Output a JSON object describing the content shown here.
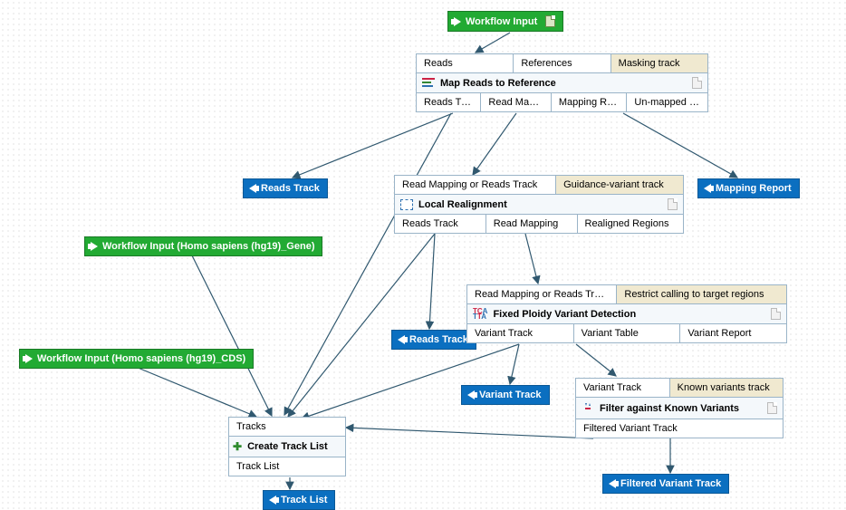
{
  "inputs": {
    "top": "Workflow Input",
    "gene": "Workflow Input (Homo sapiens (hg19)_Gene)",
    "cds": "Workflow Input (Homo sapiens (hg19)_CDS)"
  },
  "outputs": {
    "reads_track_1": "Reads Track",
    "mapping_report": "Mapping Report",
    "reads_track_2": "Reads Track",
    "variant_track": "Variant Track",
    "filtered_variant": "Filtered Variant Track",
    "track_list": "Track List"
  },
  "map": {
    "in": {
      "reads": "Reads",
      "refs": "References",
      "mask": "Masking track"
    },
    "title": "Map Reads to Reference",
    "out": {
      "rt": "Reads Track",
      "rm": "Read Mapping",
      "mr": "Mapping Report",
      "um": "Un-mapped Reads"
    }
  },
  "realign": {
    "in": {
      "rm": "Read Mapping or Reads Track",
      "gv": "Guidance-variant track"
    },
    "title": "Local Realignment",
    "out": {
      "rt": "Reads Track",
      "rm": "Read Mapping",
      "rr": "Realigned Regions"
    }
  },
  "fpvd": {
    "in": {
      "rm": "Read Mapping or Reads Track",
      "rc": "Restrict calling to target regions"
    },
    "title": "Fixed Ploidy Variant Detection",
    "out": {
      "vt": "Variant Track",
      "vtab": "Variant Table",
      "vr": "Variant Report"
    }
  },
  "filter": {
    "in": {
      "vt": "Variant Track",
      "kv": "Known variants track"
    },
    "title": "Filter against Known Variants",
    "out": {
      "fv": "Filtered Variant Track"
    }
  },
  "tracklist": {
    "in": {
      "tracks": "Tracks"
    },
    "title": "Create Track List",
    "out": {
      "tl": "Track List"
    }
  }
}
